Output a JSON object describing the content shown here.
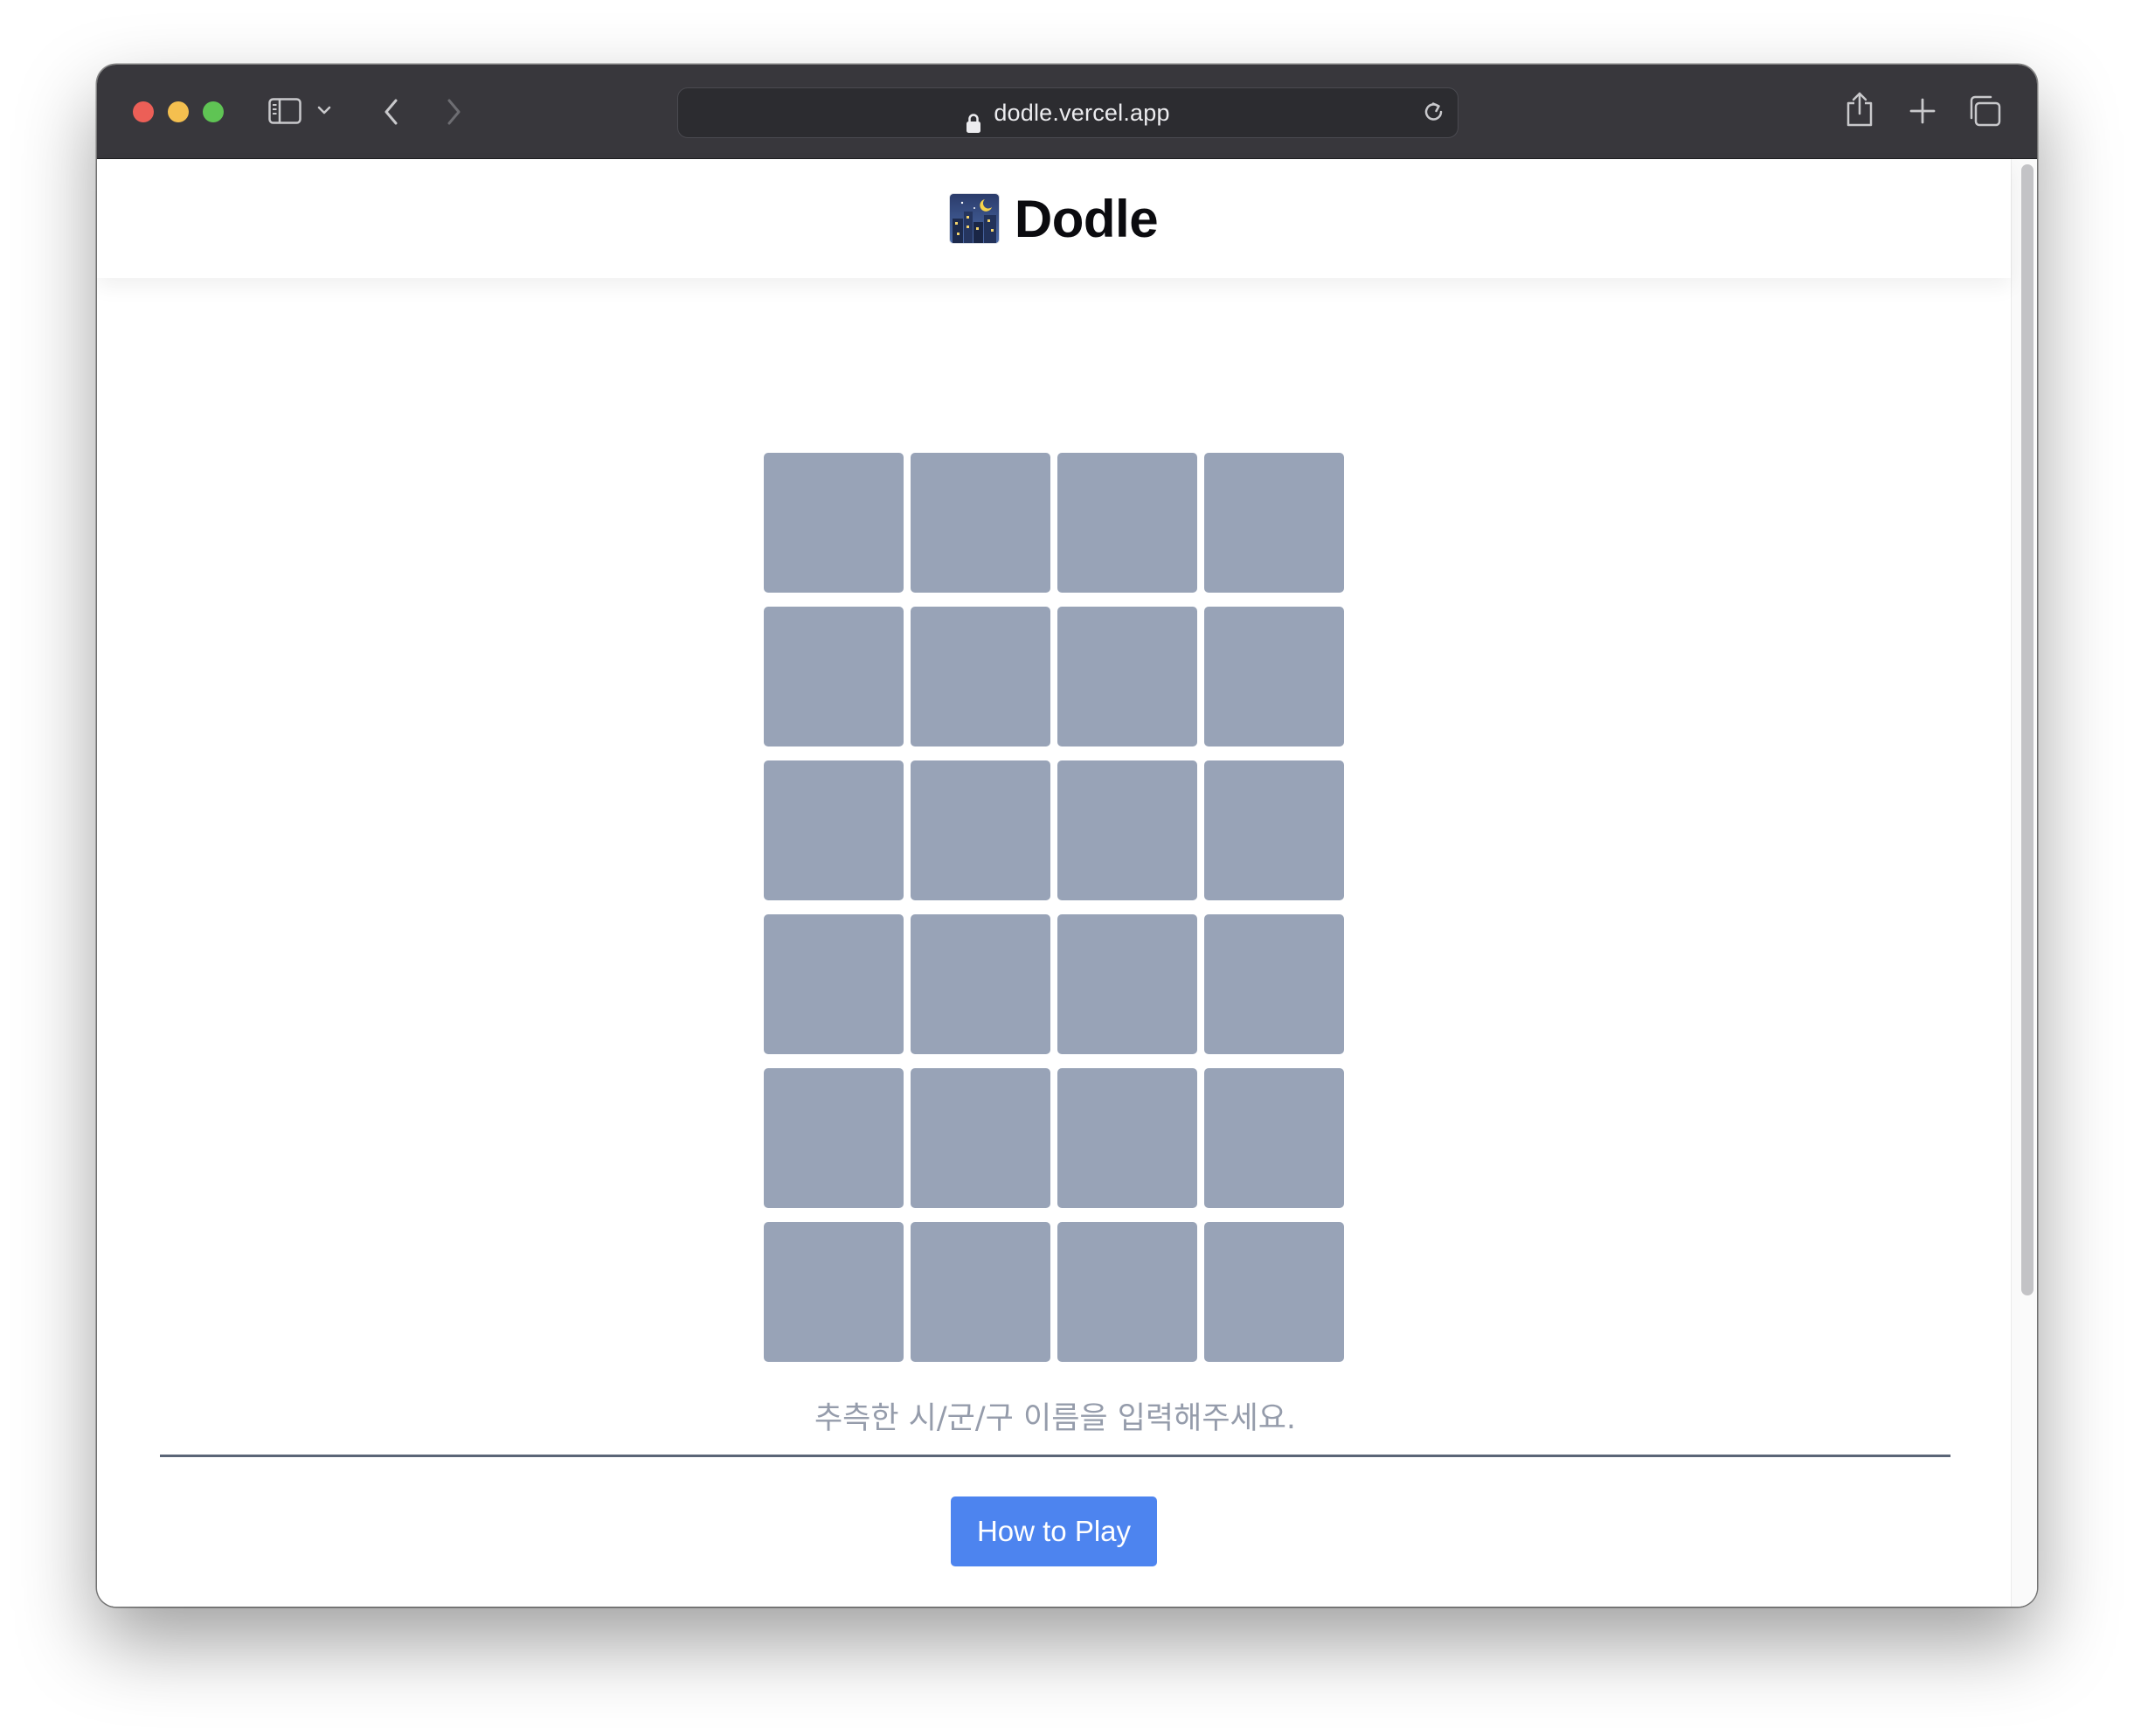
{
  "browser": {
    "url": "dodle.vercel.app",
    "traffic_lights": {
      "close_color": "#ec5f57",
      "minimize_color": "#f4bf4f",
      "zoom_color": "#5fc454"
    },
    "toolbar_icons": [
      "sidebar-icon",
      "chevron-down-icon",
      "back-icon",
      "forward-icon",
      "lock-icon",
      "reload-icon",
      "share-icon",
      "plus-icon",
      "tabs-icon"
    ]
  },
  "site": {
    "title": "Dodle",
    "logo_icon": "night-city-emoji-icon"
  },
  "board": {
    "rows": 6,
    "columns": 4,
    "tile_color": "#98a3b7"
  },
  "guess": {
    "placeholder": "추측한 시/군/구 이름을 입력해주세요."
  },
  "help_button": {
    "label": "How to Play",
    "color": "#4d84ef"
  }
}
